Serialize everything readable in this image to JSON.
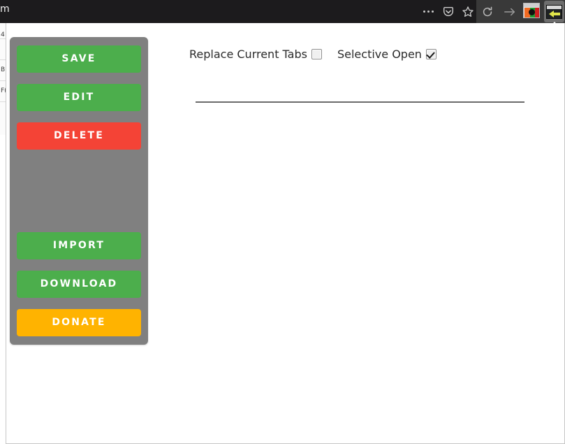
{
  "browser": {
    "url_remnant": "m",
    "toolbar_icons": [
      {
        "name": "overflow-menu-icon",
        "glyph": "•••"
      },
      {
        "name": "pocket-icon",
        "glyph": "pocket"
      },
      {
        "name": "bookmark-star-icon",
        "glyph": "★"
      },
      {
        "name": "reload-icon",
        "glyph": "⟳"
      },
      {
        "name": "forward-arrow-icon",
        "glyph": "→"
      },
      {
        "name": "extension-icon-colorful",
        "glyph": "extension"
      },
      {
        "name": "extension-icon-active",
        "glyph": "tab-session"
      }
    ]
  },
  "background_page": {
    "cells": [
      "4",
      "B",
      "F("
    ]
  },
  "popup": {
    "buttons": [
      {
        "id": "save",
        "label": "SAVE",
        "style": "green"
      },
      {
        "id": "edit",
        "label": "EDIT",
        "style": "green"
      },
      {
        "id": "delete",
        "label": "DELETE",
        "style": "red"
      },
      {
        "id": "import",
        "label": "IMPORT",
        "style": "green"
      },
      {
        "id": "download",
        "label": "DOWNLOAD",
        "style": "green"
      },
      {
        "id": "donate",
        "label": "DONATE",
        "style": "orange"
      }
    ],
    "options": [
      {
        "id": "replace-current-tabs",
        "label": "Replace Current Tabs",
        "checked": false
      },
      {
        "id": "selective-open",
        "label": "Selective Open",
        "checked": true
      }
    ]
  },
  "colors": {
    "green": "#4cae4c",
    "red": "#f44336",
    "orange": "#ffb300",
    "panel_gray": "#808080",
    "chrome_dark": "#1c1b1d",
    "chrome_mid": "#393939"
  }
}
